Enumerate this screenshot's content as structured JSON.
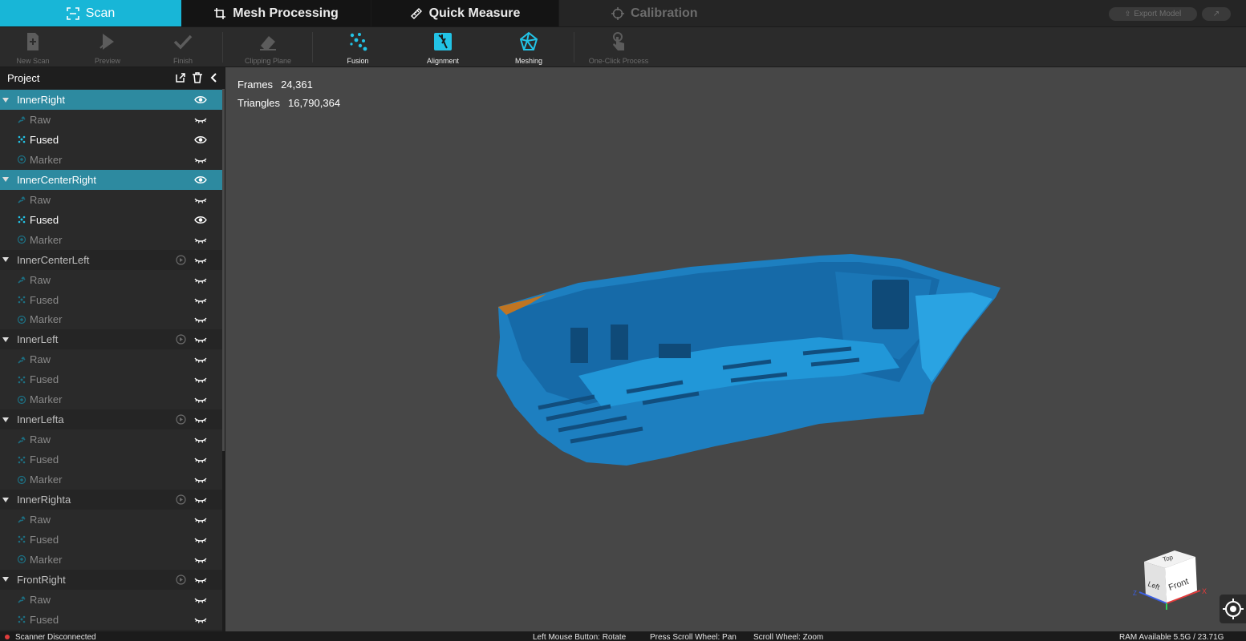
{
  "tabs": {
    "scan": "Scan",
    "mesh": "Mesh Processing",
    "measure": "Quick Measure",
    "calibration": "Calibration"
  },
  "top_right": {
    "export": "Export Model"
  },
  "toolbar": {
    "new_scan": "New Scan",
    "preview": "Preview",
    "finish": "Finish",
    "clipping": "Clipping Plane",
    "fusion": "Fusion",
    "alignment": "Alignment",
    "meshing": "Meshing",
    "one_click": "One-Click Process"
  },
  "project": {
    "title": "Project",
    "groups": [
      {
        "name": "InnerRight",
        "selected": true,
        "children": [
          {
            "label": "Raw",
            "visible": false
          },
          {
            "label": "Fused",
            "visible": true
          },
          {
            "label": "Marker",
            "visible": false
          }
        ]
      },
      {
        "name": "InnerCenterRight",
        "selected": true,
        "children": [
          {
            "label": "Raw",
            "visible": false
          },
          {
            "label": "Fused",
            "visible": true
          },
          {
            "label": "Marker",
            "visible": false
          }
        ]
      },
      {
        "name": "InnerCenterLeft",
        "selected": false,
        "children": [
          {
            "label": "Raw",
            "visible": false
          },
          {
            "label": "Fused",
            "visible": false
          },
          {
            "label": "Marker",
            "visible": false
          }
        ]
      },
      {
        "name": "InnerLeft",
        "selected": false,
        "children": [
          {
            "label": "Raw",
            "visible": false
          },
          {
            "label": "Fused",
            "visible": false
          },
          {
            "label": "Marker",
            "visible": false
          }
        ]
      },
      {
        "name": "InnerLefta",
        "selected": false,
        "children": [
          {
            "label": "Raw",
            "visible": false
          },
          {
            "label": "Fused",
            "visible": false
          },
          {
            "label": "Marker",
            "visible": false
          }
        ]
      },
      {
        "name": "InnerRighta",
        "selected": false,
        "children": [
          {
            "label": "Raw",
            "visible": false
          },
          {
            "label": "Fused",
            "visible": false
          },
          {
            "label": "Marker",
            "visible": false
          }
        ]
      },
      {
        "name": "FrontRight",
        "selected": false,
        "children": [
          {
            "label": "Raw",
            "visible": false
          },
          {
            "label": "Fused",
            "visible": false
          }
        ]
      }
    ]
  },
  "viewport": {
    "frames_label": "Frames",
    "frames_value": "24,361",
    "triangles_label": "Triangles",
    "triangles_value": "16,790,364",
    "cube_top": "Top",
    "cube_left": "Left",
    "cube_front": "Front",
    "axis_x": "X",
    "axis_z": "Z"
  },
  "status": {
    "scanner": "Scanner Disconnected",
    "left_mouse": "Left Mouse Button: Rotate",
    "scroll_press": "Press Scroll Wheel: Pan",
    "scroll_wheel": "Scroll Wheel: Zoom",
    "ram": "RAM Available 5.5G / 23.71G"
  },
  "colors": {
    "accent": "#18b6d7",
    "selected_row": "#2d8aa0",
    "model": "#1a86c9",
    "viewport_bg": "#474747"
  }
}
